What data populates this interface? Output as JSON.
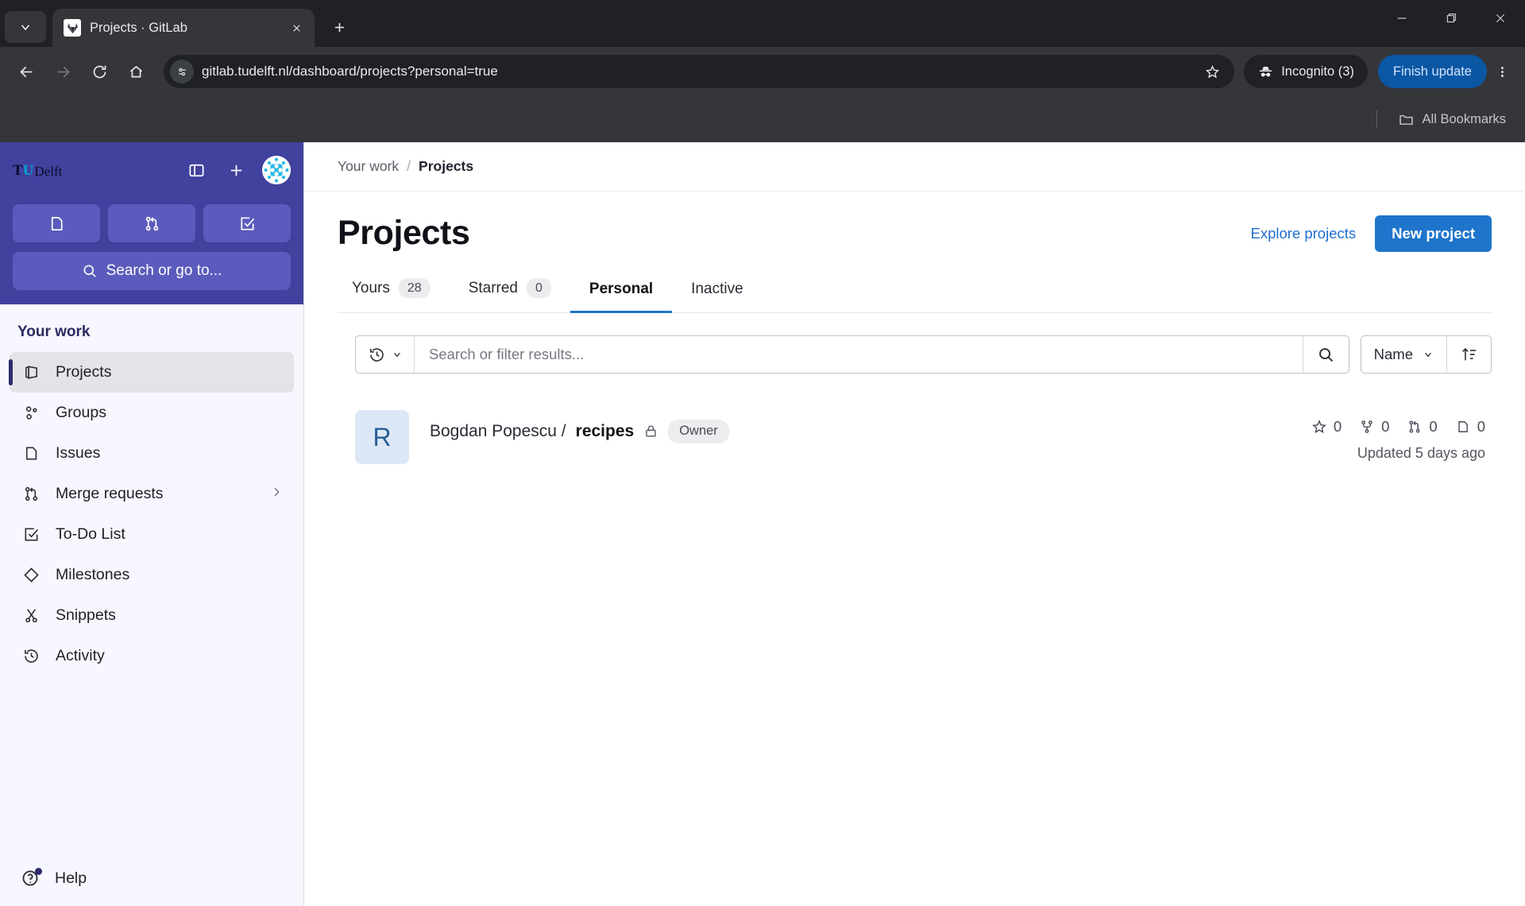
{
  "browser": {
    "tab": {
      "title": "Projects · GitLab",
      "favicon": "gitlab-favicon"
    },
    "tab_list_icon": "chevron-down-icon",
    "new_tab_icon": "plus-icon",
    "window_controls": {
      "minimize": "minimize-icon",
      "maximize": "maximize-icon",
      "close": "close-icon"
    },
    "nav": {
      "back": "back-arrow-icon",
      "forward": "forward-arrow-icon",
      "reload": "reload-icon",
      "home": "home-icon"
    },
    "omnibox": {
      "site_icon": "site-settings-icon",
      "url": "gitlab.tudelft.nl/dashboard/projects?personal=true",
      "bookmark_icon": "star-icon"
    },
    "incognito": {
      "label": "Incognito (3)",
      "icon": "incognito-icon"
    },
    "finish_update": {
      "label": "Finish update",
      "color": "#0b57a4"
    },
    "menu_icon": "kebab-menu-icon",
    "bookmarks": {
      "all_bookmarks_label": "All Bookmarks",
      "folder_icon": "folder-icon"
    }
  },
  "sidebar": {
    "brand": {
      "t": "T",
      "u": "U",
      "delft": "Delft"
    },
    "toggle_icon": "sidebar-toggle-icon",
    "create_icon": "plus-icon",
    "avatar": "user-avatar",
    "shortcuts": [
      {
        "name": "issues-shortcut",
        "icon": "issues-icon"
      },
      {
        "name": "merge-requests-shortcut",
        "icon": "merge-request-icon"
      },
      {
        "name": "todo-shortcut",
        "icon": "todo-icon"
      }
    ],
    "search": {
      "label": "Search or go to...",
      "icon": "search-icon"
    },
    "section_heading": "Your work",
    "items": [
      {
        "label": "Projects",
        "icon": "project-icon",
        "active": true,
        "chevron": false
      },
      {
        "label": "Groups",
        "icon": "group-icon",
        "active": false,
        "chevron": false
      },
      {
        "label": "Issues",
        "icon": "issues-icon",
        "active": false,
        "chevron": false
      },
      {
        "label": "Merge requests",
        "icon": "merge-request-icon",
        "active": false,
        "chevron": true
      },
      {
        "label": "To-Do List",
        "icon": "todo-icon",
        "active": false,
        "chevron": false
      },
      {
        "label": "Milestones",
        "icon": "milestone-icon",
        "active": false,
        "chevron": false
      },
      {
        "label": "Snippets",
        "icon": "snippet-icon",
        "active": false,
        "chevron": false
      },
      {
        "label": "Activity",
        "icon": "activity-icon",
        "active": false,
        "chevron": false
      }
    ],
    "help": {
      "label": "Help",
      "icon": "help-icon",
      "has_notification_dot": true
    }
  },
  "breadcrumb": {
    "parent": "Your work",
    "separator": "/",
    "current": "Projects"
  },
  "main": {
    "title": "Projects",
    "explore_label": "Explore projects",
    "new_project_label": "New project",
    "primary_color": "#1f75cb",
    "tabs": [
      {
        "label": "Yours",
        "count": "28",
        "active": false
      },
      {
        "label": "Starred",
        "count": "0",
        "active": false
      },
      {
        "label": "Personal",
        "count": null,
        "active": true
      },
      {
        "label": "Inactive",
        "count": null,
        "active": false
      }
    ],
    "filter": {
      "history_icon": "history-icon",
      "search_placeholder": "Search or filter results...",
      "search_value": "",
      "search_button_icon": "search-icon",
      "sort_label": "Name",
      "sort_direction_icon": "sort-ascending-icon"
    },
    "projects": [
      {
        "avatar_letter": "R",
        "namespace": "Bogdan Popescu /",
        "name": "recipes",
        "visibility_icon": "lock-icon",
        "role_badge": "Owner",
        "stats": [
          {
            "icon": "star-icon",
            "value": "0"
          },
          {
            "icon": "fork-icon",
            "value": "0"
          },
          {
            "icon": "merge-request-icon",
            "value": "0"
          },
          {
            "icon": "issues-icon",
            "value": "0"
          }
        ],
        "updated": "Updated 5 days ago"
      }
    ]
  }
}
